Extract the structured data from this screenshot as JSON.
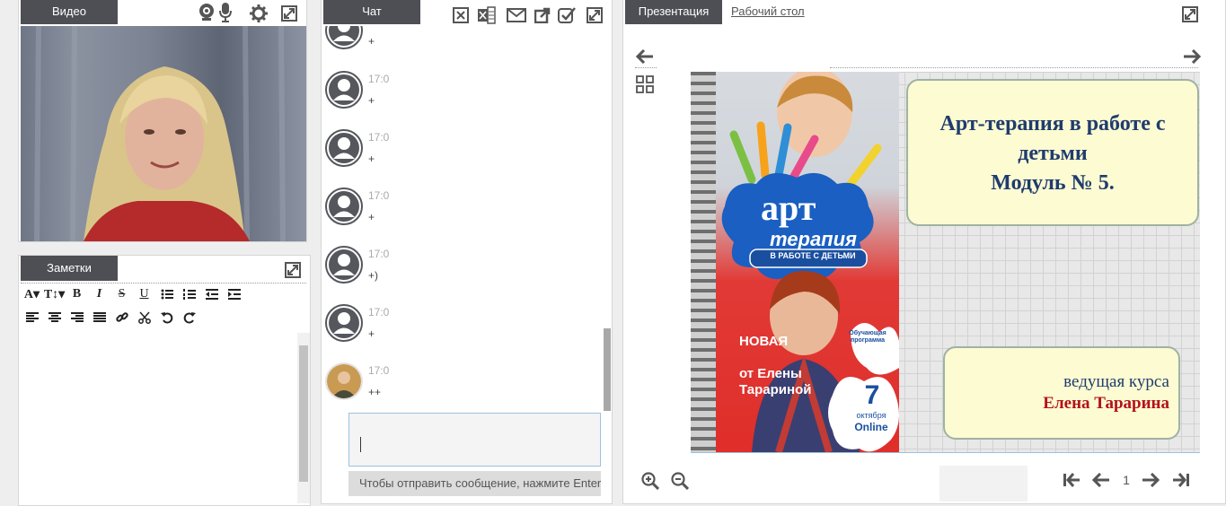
{
  "video": {
    "tab_label": "Видео"
  },
  "notes": {
    "tab_label": "Заметки",
    "toolbar_row1": [
      "A▾",
      "T↕▾",
      "B",
      "I",
      "S",
      "U"
    ],
    "toolbar_row2": []
  },
  "chat": {
    "tab_label": "Чат",
    "messages": [
      {
        "time": "",
        "text": "+"
      },
      {
        "time": "17:0",
        "text": "+"
      },
      {
        "time": "17:0",
        "text": "+"
      },
      {
        "time": "17:0",
        "text": "+"
      },
      {
        "time": "17:0",
        "text": "+)"
      },
      {
        "time": "17:0",
        "text": "+"
      },
      {
        "time": "17:0",
        "text": "++"
      }
    ],
    "input_value": "",
    "hint": "Чтобы отправить сообщение, нажмите Enter"
  },
  "presentation": {
    "tab_label": "Презентация",
    "desktop_link": "Рабочий стол",
    "page_number": "1",
    "slide": {
      "title_lines": [
        "Арт-терапия в работе с",
        "детьми",
        "Модуль № 5."
      ],
      "host_label": "ведущая курса",
      "host_name": "Елена Тарарина",
      "book_title1": "арт",
      "book_title2": "терапия",
      "book_subtitle": "В РАБОТЕ С ДЕТЬМИ",
      "book_new": "НОВАЯ",
      "book_from": "от Елены",
      "book_author": "Тарариной",
      "badge_text": "Обучающая программа",
      "date_day": "7",
      "date_month": "октября",
      "date_mode": "Online"
    },
    "colors": {
      "title": "#1f3c6d",
      "host_name": "#b3121a",
      "tab_bg": "#4d4f55"
    }
  }
}
